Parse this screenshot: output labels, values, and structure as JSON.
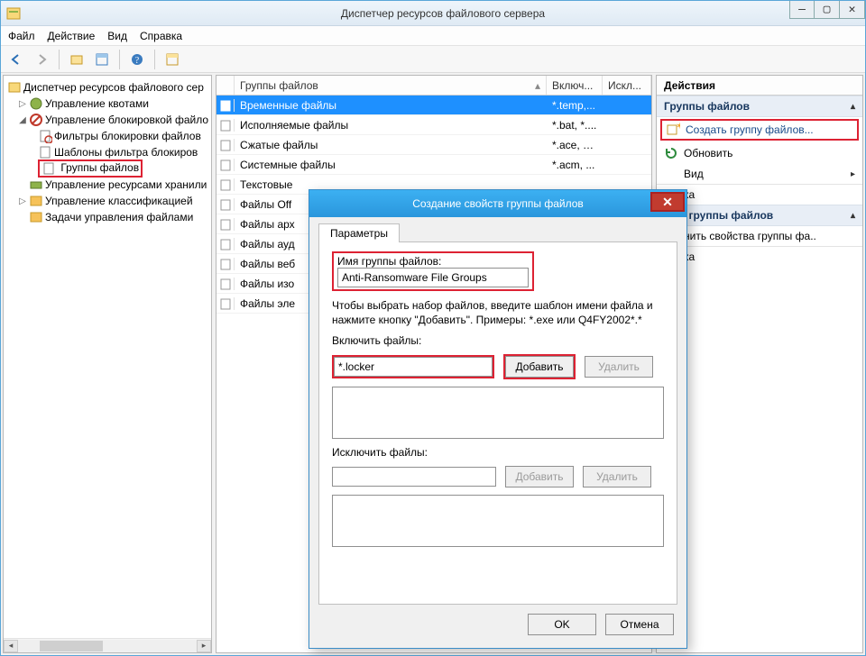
{
  "window": {
    "title": "Диспетчер ресурсов файлового сервера",
    "buttons": {
      "min": "—",
      "max": "▢",
      "close": "✕"
    }
  },
  "menubar": {
    "file": "Файл",
    "action": "Действие",
    "view": "Вид",
    "help": "Справка"
  },
  "tree": {
    "root": "Диспетчер ресурсов файлового сер",
    "nodes": {
      "quotas": "Управление квотами",
      "blocking": "Управление блокировкой файло",
      "filters": "Фильтры блокировки файлов",
      "templates": "Шаблоны фильтра блокиров",
      "groups": "Группы файлов",
      "storage": "Управление ресурсами хранили",
      "classif": "Управление классификацией",
      "tasks": "Задачи управления файлами"
    }
  },
  "list": {
    "headers": {
      "name": "Группы файлов",
      "include": "Включ...",
      "exclude": "Искл..."
    },
    "rows": [
      {
        "name": "Временные файлы",
        "inc": "*.temp,...",
        "exc": ""
      },
      {
        "name": "Исполняемые файлы",
        "inc": "*.bat, *....",
        "exc": ""
      },
      {
        "name": "Сжатые файлы",
        "inc": "*.ace, *....",
        "exc": ""
      },
      {
        "name": "Системные файлы",
        "inc": "*.acm, ...",
        "exc": ""
      },
      {
        "name": "Текстовые",
        "inc": "",
        "exc": ""
      },
      {
        "name": "Файлы Off",
        "inc": "",
        "exc": ""
      },
      {
        "name": "Файлы арх",
        "inc": "",
        "exc": ""
      },
      {
        "name": "Файлы ауд",
        "inc": "",
        "exc": ""
      },
      {
        "name": "Файлы веб",
        "inc": "",
        "exc": ""
      },
      {
        "name": "Файлы изо",
        "inc": "",
        "exc": ""
      },
      {
        "name": "Файлы эле",
        "inc": "",
        "exc": ""
      }
    ]
  },
  "actions": {
    "title": "Действия",
    "section1": "Группы файлов",
    "createGroup": "Создать группу файлов...",
    "refresh": "Обновить",
    "view": "Вид",
    "helpItem": "ка",
    "section2": "ные группы файлов",
    "editProps": "нить свойства группы фа..",
    "helpItem2": "ка"
  },
  "dialog": {
    "title": "Создание свойств группы файлов",
    "tab": "Параметры",
    "groupNameLabel": "Имя группы файлов:",
    "groupNameValue": "Anti-Ransomware File Groups",
    "hint": "Чтобы выбрать набор файлов, введите шаблон имени файла и нажмите кнопку \"Добавить\". Примеры: *.exe или Q4FY2002*.*",
    "includeLabel": "Включить файлы:",
    "includeValue": "*.locker",
    "add": "Добавить",
    "remove": "Удалить",
    "excludeLabel": "Исключить файлы:",
    "ok": "OK",
    "cancel": "Отмена"
  }
}
